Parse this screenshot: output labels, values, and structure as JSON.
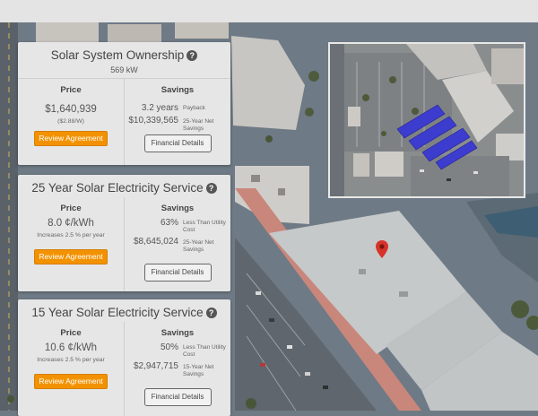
{
  "cards": [
    {
      "title": "Solar System Ownership",
      "subtitle": "569 kW",
      "price_heading": "Price",
      "price_main": "$1,640,939",
      "price_sub": "($2.88/W)",
      "review_label": "Review Agreement",
      "savings_heading": "Savings",
      "savings_rows": [
        {
          "value": "3.2 years",
          "label": "Payback"
        },
        {
          "value": "$10,339,565",
          "label": "25-Year Net Savings"
        }
      ],
      "details_label": "Financial Details"
    },
    {
      "title": "25 Year Solar Electricity Service",
      "price_heading": "Price",
      "price_main": "8.0 ¢/kWh",
      "price_sub": "Increases 2.5 % per year",
      "review_label": "Review Agreement",
      "savings_heading": "Savings",
      "savings_rows": [
        {
          "value": "63%",
          "label": "Less Than Utility Cost"
        },
        {
          "value": "$8,645,024",
          "label": "25-Year Net Savings"
        }
      ],
      "details_label": "Financial Details"
    },
    {
      "title": "15 Year Solar Electricity Service",
      "price_heading": "Price",
      "price_main": "10.6 ¢/kWh",
      "price_sub": "Increases 2.5 % per year",
      "review_label": "Review Agreement",
      "savings_heading": "Savings",
      "savings_rows": [
        {
          "value": "50%",
          "label": "Less Than Utility Cost"
        },
        {
          "value": "$2,947,715",
          "label": "15-Year Net Savings"
        }
      ],
      "details_label": "Financial Details"
    }
  ],
  "icons": {
    "help": "help-circle-icon",
    "marker": "map-marker-icon"
  },
  "colors": {
    "accent": "#f39200",
    "panel": "#e6e6e6",
    "solar_panel": "#3c3ccf",
    "marker": "#d7322a"
  }
}
